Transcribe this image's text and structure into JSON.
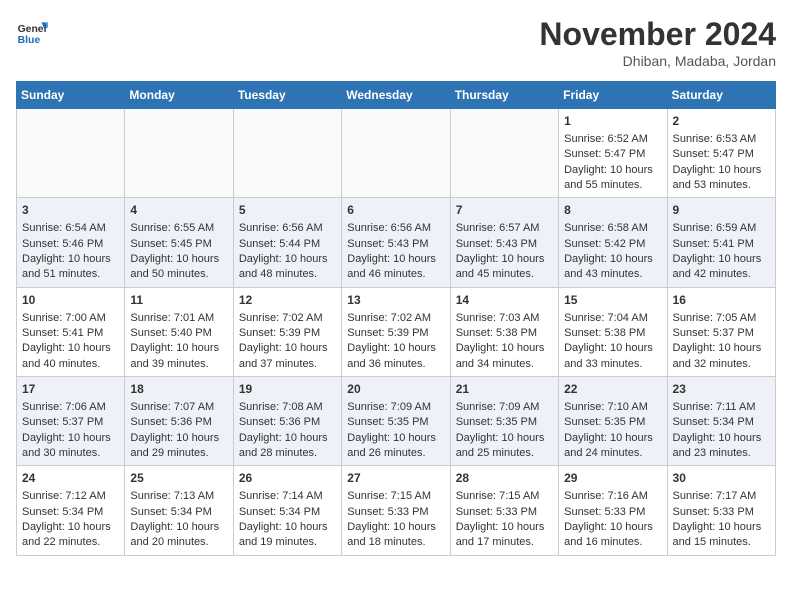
{
  "header": {
    "logo_line1": "General",
    "logo_line2": "Blue",
    "month": "November 2024",
    "location": "Dhiban, Madaba, Jordan"
  },
  "days_of_week": [
    "Sunday",
    "Monday",
    "Tuesday",
    "Wednesday",
    "Thursday",
    "Friday",
    "Saturday"
  ],
  "weeks": [
    [
      {
        "day": "",
        "info": ""
      },
      {
        "day": "",
        "info": ""
      },
      {
        "day": "",
        "info": ""
      },
      {
        "day": "",
        "info": ""
      },
      {
        "day": "",
        "info": ""
      },
      {
        "day": "1",
        "info": "Sunrise: 6:52 AM\nSunset: 5:47 PM\nDaylight: 10 hours and 55 minutes."
      },
      {
        "day": "2",
        "info": "Sunrise: 6:53 AM\nSunset: 5:47 PM\nDaylight: 10 hours and 53 minutes."
      }
    ],
    [
      {
        "day": "3",
        "info": "Sunrise: 6:54 AM\nSunset: 5:46 PM\nDaylight: 10 hours and 51 minutes."
      },
      {
        "day": "4",
        "info": "Sunrise: 6:55 AM\nSunset: 5:45 PM\nDaylight: 10 hours and 50 minutes."
      },
      {
        "day": "5",
        "info": "Sunrise: 6:56 AM\nSunset: 5:44 PM\nDaylight: 10 hours and 48 minutes."
      },
      {
        "day": "6",
        "info": "Sunrise: 6:56 AM\nSunset: 5:43 PM\nDaylight: 10 hours and 46 minutes."
      },
      {
        "day": "7",
        "info": "Sunrise: 6:57 AM\nSunset: 5:43 PM\nDaylight: 10 hours and 45 minutes."
      },
      {
        "day": "8",
        "info": "Sunrise: 6:58 AM\nSunset: 5:42 PM\nDaylight: 10 hours and 43 minutes."
      },
      {
        "day": "9",
        "info": "Sunrise: 6:59 AM\nSunset: 5:41 PM\nDaylight: 10 hours and 42 minutes."
      }
    ],
    [
      {
        "day": "10",
        "info": "Sunrise: 7:00 AM\nSunset: 5:41 PM\nDaylight: 10 hours and 40 minutes."
      },
      {
        "day": "11",
        "info": "Sunrise: 7:01 AM\nSunset: 5:40 PM\nDaylight: 10 hours and 39 minutes."
      },
      {
        "day": "12",
        "info": "Sunrise: 7:02 AM\nSunset: 5:39 PM\nDaylight: 10 hours and 37 minutes."
      },
      {
        "day": "13",
        "info": "Sunrise: 7:02 AM\nSunset: 5:39 PM\nDaylight: 10 hours and 36 minutes."
      },
      {
        "day": "14",
        "info": "Sunrise: 7:03 AM\nSunset: 5:38 PM\nDaylight: 10 hours and 34 minutes."
      },
      {
        "day": "15",
        "info": "Sunrise: 7:04 AM\nSunset: 5:38 PM\nDaylight: 10 hours and 33 minutes."
      },
      {
        "day": "16",
        "info": "Sunrise: 7:05 AM\nSunset: 5:37 PM\nDaylight: 10 hours and 32 minutes."
      }
    ],
    [
      {
        "day": "17",
        "info": "Sunrise: 7:06 AM\nSunset: 5:37 PM\nDaylight: 10 hours and 30 minutes."
      },
      {
        "day": "18",
        "info": "Sunrise: 7:07 AM\nSunset: 5:36 PM\nDaylight: 10 hours and 29 minutes."
      },
      {
        "day": "19",
        "info": "Sunrise: 7:08 AM\nSunset: 5:36 PM\nDaylight: 10 hours and 28 minutes."
      },
      {
        "day": "20",
        "info": "Sunrise: 7:09 AM\nSunset: 5:35 PM\nDaylight: 10 hours and 26 minutes."
      },
      {
        "day": "21",
        "info": "Sunrise: 7:09 AM\nSunset: 5:35 PM\nDaylight: 10 hours and 25 minutes."
      },
      {
        "day": "22",
        "info": "Sunrise: 7:10 AM\nSunset: 5:35 PM\nDaylight: 10 hours and 24 minutes."
      },
      {
        "day": "23",
        "info": "Sunrise: 7:11 AM\nSunset: 5:34 PM\nDaylight: 10 hours and 23 minutes."
      }
    ],
    [
      {
        "day": "24",
        "info": "Sunrise: 7:12 AM\nSunset: 5:34 PM\nDaylight: 10 hours and 22 minutes."
      },
      {
        "day": "25",
        "info": "Sunrise: 7:13 AM\nSunset: 5:34 PM\nDaylight: 10 hours and 20 minutes."
      },
      {
        "day": "26",
        "info": "Sunrise: 7:14 AM\nSunset: 5:34 PM\nDaylight: 10 hours and 19 minutes."
      },
      {
        "day": "27",
        "info": "Sunrise: 7:15 AM\nSunset: 5:33 PM\nDaylight: 10 hours and 18 minutes."
      },
      {
        "day": "28",
        "info": "Sunrise: 7:15 AM\nSunset: 5:33 PM\nDaylight: 10 hours and 17 minutes."
      },
      {
        "day": "29",
        "info": "Sunrise: 7:16 AM\nSunset: 5:33 PM\nDaylight: 10 hours and 16 minutes."
      },
      {
        "day": "30",
        "info": "Sunrise: 7:17 AM\nSunset: 5:33 PM\nDaylight: 10 hours and 15 minutes."
      }
    ]
  ]
}
